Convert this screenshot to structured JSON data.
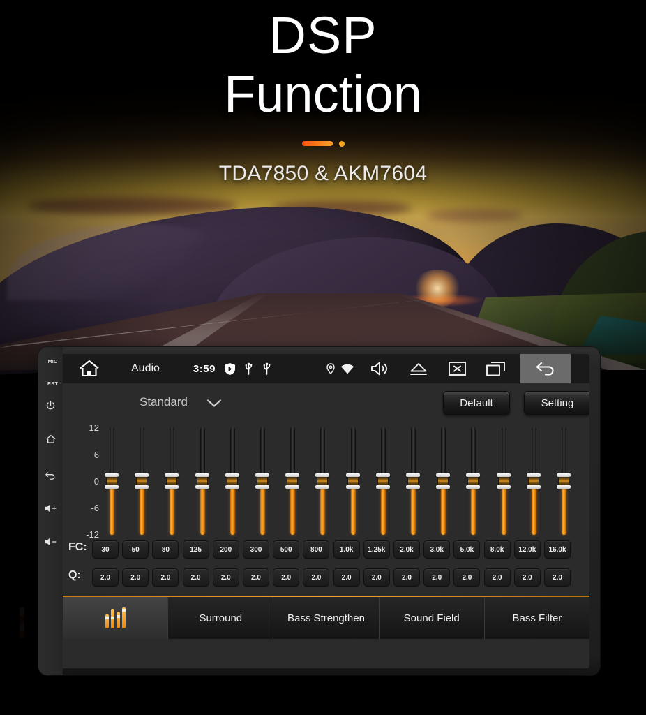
{
  "hero": {
    "title_line1": "DSP",
    "title_line2": "Function",
    "subtitle": "TDA7850 & AKM7604",
    "accent_color": "#f2530c",
    "accent_dot_color": "#f9a826"
  },
  "device": {
    "bezel": {
      "items": [
        {
          "name": "mic-indicator",
          "label": "MIC"
        },
        {
          "name": "reset-indicator",
          "label": "RST"
        },
        {
          "name": "power-button",
          "label": ""
        },
        {
          "name": "home-button",
          "label": ""
        },
        {
          "name": "back-button",
          "label": ""
        },
        {
          "name": "volume-up-button",
          "label": ""
        },
        {
          "name": "volume-down-button",
          "label": ""
        }
      ]
    },
    "statusbar": {
      "title": "Audio",
      "time": "3:59",
      "icons_left": [
        "home-icon"
      ],
      "icons_center": [
        "shield-play-icon",
        "usb-icon",
        "usb-icon"
      ],
      "icons_right": [
        "location-pin-icon",
        "wifi-icon",
        "speaker-icon",
        "eject-icon",
        "close-box-icon",
        "recent-apps-icon",
        "back-arrow-icon"
      ]
    },
    "toolbar": {
      "preset_label": "Standard",
      "default_label": "Default",
      "setting_label": "Setting"
    },
    "equalizer": {
      "scale_labels": [
        "12",
        "6",
        "0",
        "-6",
        "-12"
      ],
      "db_min": -12,
      "db_max": 12,
      "fc_label": "FC:",
      "q_label": "Q:",
      "bands": [
        {
          "fc": "30",
          "q": "2.0",
          "gain": 0
        },
        {
          "fc": "50",
          "q": "2.0",
          "gain": 0
        },
        {
          "fc": "80",
          "q": "2.0",
          "gain": 0
        },
        {
          "fc": "125",
          "q": "2.0",
          "gain": 0
        },
        {
          "fc": "200",
          "q": "2.0",
          "gain": 0
        },
        {
          "fc": "300",
          "q": "2.0",
          "gain": 0
        },
        {
          "fc": "500",
          "q": "2.0",
          "gain": 0
        },
        {
          "fc": "800",
          "q": "2.0",
          "gain": 0
        },
        {
          "fc": "1.0k",
          "q": "2.0",
          "gain": 0
        },
        {
          "fc": "1.25k",
          "q": "2.0",
          "gain": 0
        },
        {
          "fc": "2.0k",
          "q": "2.0",
          "gain": 0
        },
        {
          "fc": "3.0k",
          "q": "2.0",
          "gain": 0
        },
        {
          "fc": "5.0k",
          "q": "2.0",
          "gain": 0
        },
        {
          "fc": "8.0k",
          "q": "2.0",
          "gain": 0
        },
        {
          "fc": "12.0k",
          "q": "2.0",
          "gain": 0
        },
        {
          "fc": "16.0k",
          "q": "2.0",
          "gain": 0
        }
      ]
    },
    "tabs": [
      {
        "label": "",
        "icon": "equalizer-icon",
        "active": true
      },
      {
        "label": "Surround",
        "icon": "",
        "active": false
      },
      {
        "label": "Bass Strengthen",
        "icon": "",
        "active": false
      },
      {
        "label": "Sound Field",
        "icon": "",
        "active": false
      },
      {
        "label": "Bass Filter",
        "icon": "",
        "active": false
      }
    ],
    "accent_color": "#f0a42a"
  }
}
